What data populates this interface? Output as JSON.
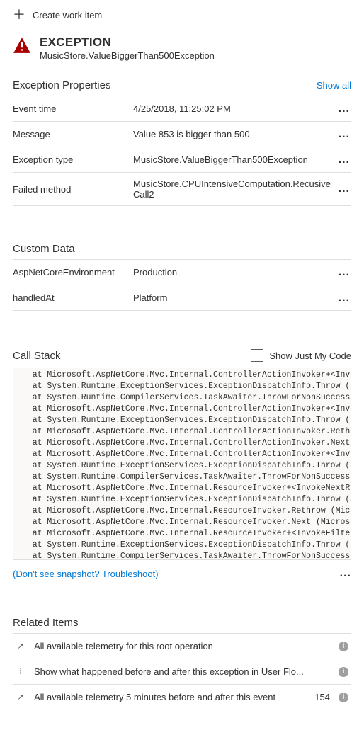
{
  "topAction": {
    "label": "Create work item"
  },
  "exception": {
    "title": "EXCEPTION",
    "subtitle": "MusicStore.ValueBiggerThan500Exception"
  },
  "propsSection": {
    "title": "Exception Properties",
    "showAll": "Show all",
    "rows": [
      {
        "key": "Event time",
        "value": "4/25/2018, 11:25:02 PM"
      },
      {
        "key": "Message",
        "value": "Value 853 is bigger than 500"
      },
      {
        "key": "Exception type",
        "value": "MusicStore.ValueBiggerThan500Exception"
      },
      {
        "key": "Failed method",
        "value": "MusicStore.CPUIntensiveComputation.RecusiveCall2"
      }
    ]
  },
  "customData": {
    "title": "Custom Data",
    "rows": [
      {
        "key": "AspNetCoreEnvironment",
        "value": "Production"
      },
      {
        "key": "handledAt",
        "value": "Platform"
      }
    ]
  },
  "callStack": {
    "title": "Call Stack",
    "checkboxLabel": "Show Just My Code",
    "lines": [
      "   at Microsoft.AspNetCore.Mvc.Internal.ControllerActionInvoker+<Invoke",
      "   at System.Runtime.ExceptionServices.ExceptionDispatchInfo.Throw (Sys",
      "   at System.Runtime.CompilerServices.TaskAwaiter.ThrowForNonSuccess (S",
      "   at Microsoft.AspNetCore.Mvc.Internal.ControllerActionInvoker+<Invoke",
      "   at System.Runtime.ExceptionServices.ExceptionDispatchInfo.Throw (Sys",
      "   at Microsoft.AspNetCore.Mvc.Internal.ControllerActionInvoker.Rethrow",
      "   at Microsoft.AspNetCore.Mvc.Internal.ControllerActionInvoker.Next (M",
      "   at Microsoft.AspNetCore.Mvc.Internal.ControllerActionInvoker+<Invoke",
      "   at System.Runtime.ExceptionServices.ExceptionDispatchInfo.Throw (Sys",
      "   at System.Runtime.CompilerServices.TaskAwaiter.ThrowForNonSuccess (S",
      "   at Microsoft.AspNetCore.Mvc.Internal.ResourceInvoker+<InvokeNextReso",
      "   at System.Runtime.ExceptionServices.ExceptionDispatchInfo.Throw (Sys",
      "   at Microsoft.AspNetCore.Mvc.Internal.ResourceInvoker.Rethrow (Micros",
      "   at Microsoft.AspNetCore.Mvc.Internal.ResourceInvoker.Next (Microsoft",
      "   at Microsoft.AspNetCore.Mvc.Internal.ResourceInvoker+<InvokeFilterPi",
      "   at System.Runtime.ExceptionServices.ExceptionDispatchInfo.Throw (Sys",
      "   at System.Runtime.CompilerServices.TaskAwaiter.ThrowForNonSuccess (S"
    ]
  },
  "troubleshoot": {
    "text": "(Don't see snapshot? Troubleshoot)"
  },
  "related": {
    "title": "Related Items",
    "rows": [
      {
        "icon": "↗",
        "text": "All available telemetry for this root operation",
        "count": ""
      },
      {
        "icon": "⁞",
        "text": "Show what happened before and after this exception in User Flo...",
        "count": ""
      },
      {
        "icon": "↗",
        "text": "All available telemetry 5 minutes before and after this event",
        "count": "154"
      }
    ]
  }
}
